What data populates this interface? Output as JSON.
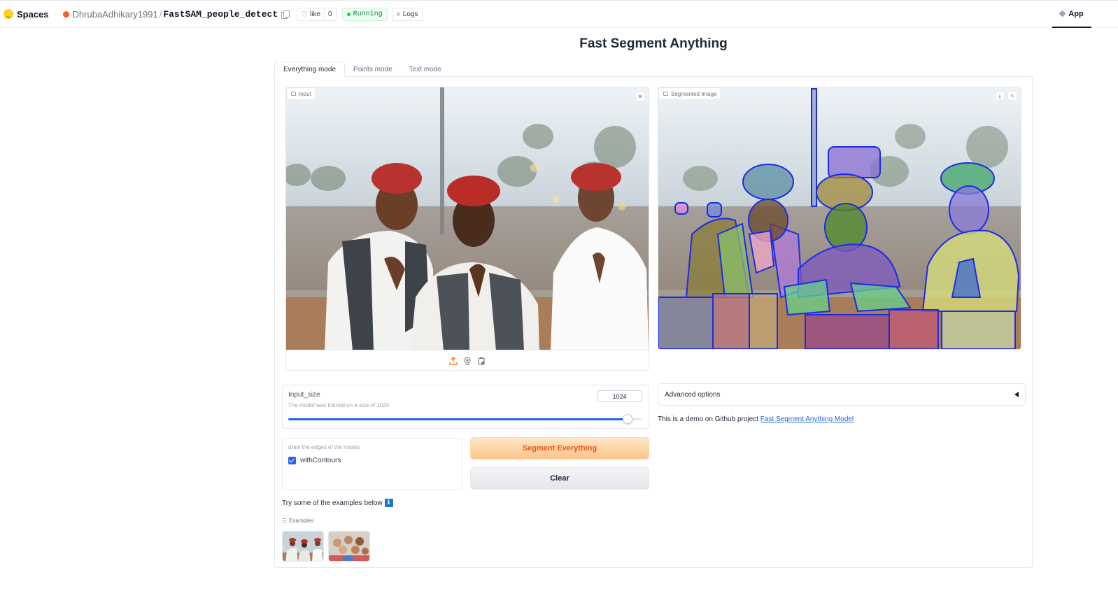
{
  "header": {
    "brand": "Spaces",
    "owner": "DhrubaAdhikary1991",
    "separator": "/",
    "repo": "FastSAM_people_detect",
    "like_label": "like",
    "like_count": "0",
    "status": "Running",
    "logs_label": "Logs",
    "app_tab": "App"
  },
  "page": {
    "title": "Fast Segment Anything",
    "tabs": [
      "Everything mode",
      "Points mode",
      "Text mode"
    ],
    "active_tab": "Everything mode"
  },
  "input_image": {
    "label": "Input",
    "icons": [
      "upload-icon",
      "webcam-icon",
      "paste-clipboard-icon"
    ]
  },
  "output_image": {
    "label": "Segmented Image",
    "icons": [
      "download-icon",
      "share-icon"
    ]
  },
  "slider": {
    "label": "Input_size",
    "info": "The model was trained on a size of 1024",
    "value": "1024",
    "fill_fraction": 0.96
  },
  "contours": {
    "info": "draw the edges of the masks",
    "label": "withContours",
    "checked": true
  },
  "buttons": {
    "segment": "Segment Everything",
    "clear": "Clear"
  },
  "advanced": {
    "label": "Advanced options"
  },
  "demo": {
    "text": "This is a demo on Github project ",
    "link": "Fast Segment Anything Model"
  },
  "examples": {
    "prompt": "Try some of the examples below",
    "label": "Examples"
  },
  "colors": {
    "accent": "#2563eb",
    "primary_button_text": "#ea580c",
    "running": "#15803d"
  }
}
